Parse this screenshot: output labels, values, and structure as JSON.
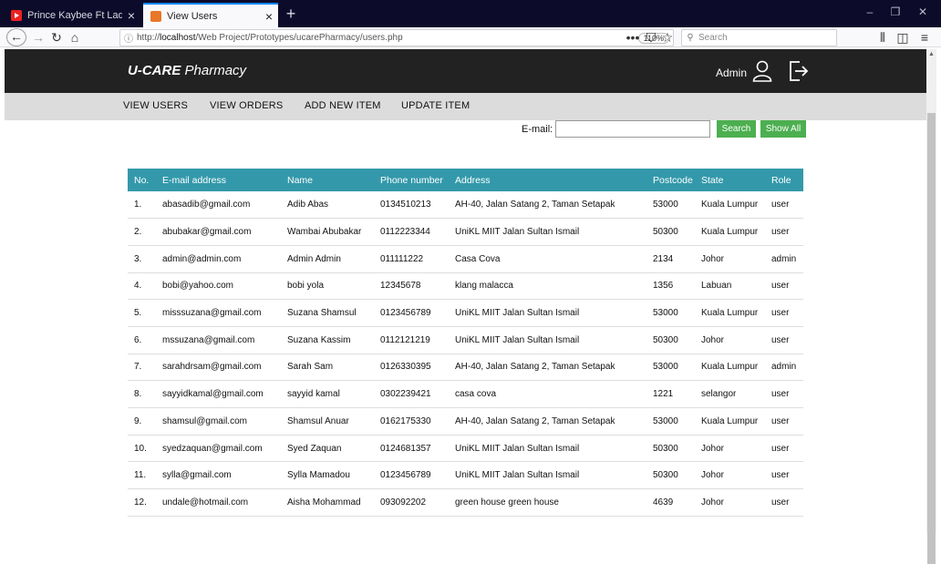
{
  "browser": {
    "tabs": [
      {
        "title": "Prince Kaybee Ft Lady Zamar -",
        "icon": "youtube-icon",
        "active": false
      },
      {
        "title": "View Users",
        "icon": "site-icon",
        "active": true
      }
    ],
    "url_prefix": "http://",
    "url_host": "localhost",
    "url_path": "/Web Project/Prototypes/ucarePharmacy/users.php",
    "zoom": "110%",
    "search_placeholder": "Search"
  },
  "header": {
    "brand_bold": "U-CARE",
    "brand_rest": " Pharmacy",
    "admin_label": "Admin"
  },
  "menu": [
    "VIEW USERS",
    "VIEW ORDERS",
    "ADD NEW ITEM",
    "UPDATE ITEM"
  ],
  "search": {
    "label": "E-mail:",
    "value": "",
    "search_button": "Search",
    "show_all_button": "Show All"
  },
  "table": {
    "columns": [
      "No.",
      "E-mail address",
      "Name",
      "Phone number",
      "Address",
      "Postcode",
      "State",
      "Role"
    ],
    "rows": [
      [
        "1.",
        "abasadib@gmail.com",
        "Adib Abas",
        "0134510213",
        "AH-40, Jalan Satang 2, Taman Setapak",
        "53000",
        "Kuala Lumpur",
        "user"
      ],
      [
        "2.",
        "abubakar@gmail.com",
        "Wambai Abubakar",
        "0112223344",
        "UniKL MIIT Jalan Sultan Ismail",
        "50300",
        "Kuala Lumpur",
        "user"
      ],
      [
        "3.",
        "admin@admin.com",
        "Admin Admin",
        "011111222",
        "Casa Cova",
        "2134",
        "Johor",
        "admin"
      ],
      [
        "4.",
        "bobi@yahoo.com",
        "bobi yola",
        "12345678",
        "klang malacca",
        "1356",
        "Labuan",
        "user"
      ],
      [
        "5.",
        "misssuzana@gmail.com",
        "Suzana Shamsul",
        "0123456789",
        "UniKL MIIT Jalan Sultan Ismail",
        "53000",
        "Kuala Lumpur",
        "user"
      ],
      [
        "6.",
        "mssuzana@gmail.com",
        "Suzana Kassim",
        "0112121219",
        "UniKL MIIT Jalan Sultan Ismail",
        "50300",
        "Johor",
        "user"
      ],
      [
        "7.",
        "sarahdrsam@gmail.com",
        "Sarah Sam",
        "0126330395",
        "AH-40, Jalan Satang 2, Taman Setapak",
        "53000",
        "Kuala Lumpur",
        "admin"
      ],
      [
        "8.",
        "sayyidkamal@gmail.com",
        "sayyid kamal",
        "0302239421",
        "casa cova",
        "1221",
        "selangor",
        "user"
      ],
      [
        "9.",
        "shamsul@gmail.com",
        "Shamsul Anuar",
        "0162175330",
        "AH-40, Jalan Satang 2, Taman Setapak",
        "53000",
        "Kuala Lumpur",
        "user"
      ],
      [
        "10.",
        "syedzaquan@gmail.com",
        "Syed Zaquan",
        "0124681357",
        "UniKL MIIT Jalan Sultan Ismail",
        "50300",
        "Johor",
        "user"
      ],
      [
        "11.",
        "sylla@gmail.com",
        "Sylla Mamadou",
        "0123456789",
        "UniKL MIIT Jalan Sultan Ismail",
        "50300",
        "Johor",
        "user"
      ],
      [
        "12.",
        "undale@hotmail.com",
        "Aisha Mohammad",
        "093092202",
        "green house green house",
        "4639",
        "Johor",
        "user"
      ]
    ]
  },
  "colors": {
    "table_header": "#3399aa",
    "button_green": "#4caf50",
    "header_bg": "#222222",
    "menu_bg": "#dcdcdc"
  }
}
